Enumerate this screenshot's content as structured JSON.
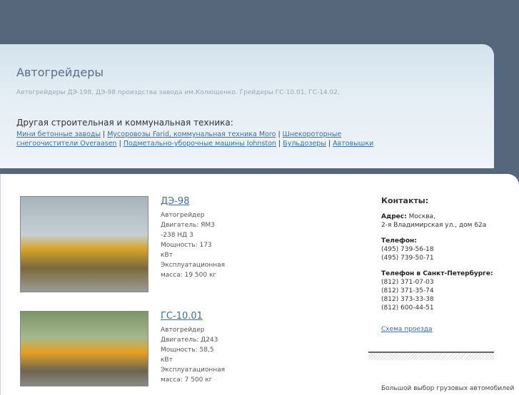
{
  "header": {
    "title": "Автогрейдеры",
    "description": "Автогрейдеры ДЭ-198, ДЭ-98 произдства завода им.Колющенко. Грейдеры ГС-10.01, ГС-14.02.",
    "other_label": "Другая строительная и коммунальная техника:",
    "links": [
      "Мини бетонные заводы",
      "Мусоровозы Farid, коммунальная техника Moro",
      "Шнекороторные снегоочистители Overaasen",
      "Подметально-уборочные машины Johnston",
      "Бульдозеры",
      "Автовышки"
    ],
    "separator": "|"
  },
  "products": [
    {
      "name": "ДЭ-98",
      "type": "Автогрейдер",
      "engine": "Двигатель: ЯМЗ -238 НД 3",
      "power": "Мощность: 173 кВт",
      "mass": "Эксплуатационная масса: 19 500 кг"
    },
    {
      "name": "ГС-10.01",
      "type": "Автогрейдер",
      "engine": "Двигатель: Д243",
      "power": "Мощность: 58,5 кВт",
      "mass": "Эксплуатационная масса: 7 500 кг"
    }
  ],
  "contacts": {
    "title": "Контакты:",
    "address_label": "Адрес:",
    "address_city": "Москва,",
    "address_street": "2-я Владимирская ул., дом 62а",
    "phone_label": "Телефон:",
    "phones": [
      "(495) 739-56-18",
      "(495) 739-50-71"
    ],
    "spb_label": "Телефон в Санкт-Петербурге:",
    "spb_phones": [
      "(812) 371-07-03",
      "(812) 371-35-74",
      "(812) 373-33-38",
      "(812) 600-44-51"
    ],
    "map_link": "Схема проезда"
  },
  "bottom_text": "Большой выбор грузовых автомобилей"
}
